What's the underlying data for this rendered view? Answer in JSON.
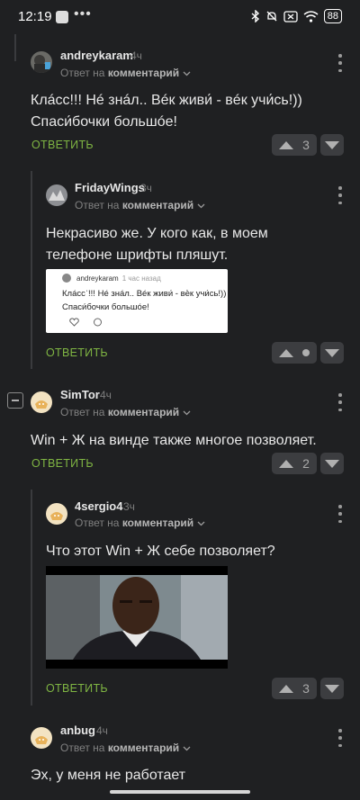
{
  "status": {
    "time": "12:19",
    "battery": "88"
  },
  "comments": [
    {
      "user": "andreykaram",
      "time": "4ч",
      "meta_prefix": "Ответ на",
      "meta_link": "комментарий",
      "text_lines": [
        "Клáсс!!! Нé знáл.. Вéк живи́ - вéк учи́сь!))",
        "Спаси́бочки большóе!"
      ],
      "reply": "ОТВЕТИТЬ",
      "score": "3"
    },
    {
      "user": "FridayWings",
      "time": "3ч",
      "meta_prefix": "Ответ на",
      "meta_link": "комментарий",
      "text_lines": [
        "Некрасиво же. У кого как, в моем",
        "телефоне шрифты пляшут."
      ],
      "embed": {
        "name": "andreykaram",
        "time": "1 час назад",
        "text_lines": [
          "Клáссˈ!!! Нé знáл.. Вéк живи́ - вѐк учи́сь!))",
          "Спаси́бочки большóе!"
        ]
      },
      "reply": "ОТВЕТИТЬ",
      "score": ""
    },
    {
      "user": "SimTor",
      "time": "4ч",
      "meta_prefix": "Ответ на",
      "meta_link": "комментарий",
      "text_lines": [
        "Win + Ж на винде также многое позволяет."
      ],
      "reply": "ОТВЕТИТЬ",
      "score": "2"
    },
    {
      "user": "4sergio4",
      "time": "3ч",
      "meta_prefix": "Ответ на",
      "meta_link": "комментарий",
      "text_lines": [
        "Что этот Win + Ж себе позволяет?"
      ],
      "reply": "ОТВЕТИТЬ",
      "score": "3"
    },
    {
      "user": "anbug",
      "time": "4ч",
      "meta_prefix": "Ответ на",
      "meta_link": "комментарий",
      "text_lines": [
        "Эх, у меня не работает"
      ]
    }
  ]
}
